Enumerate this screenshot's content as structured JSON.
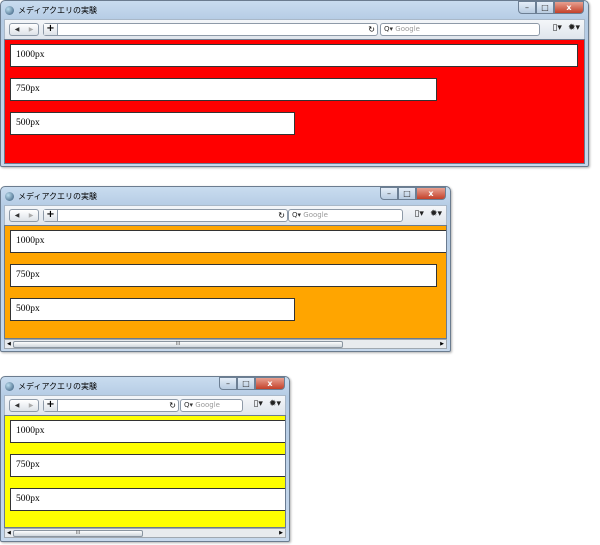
{
  "window_title": "メディアクエリの実験",
  "search_placeholder": "Google",
  "boxes": [
    "1000px",
    "750px",
    "500px"
  ],
  "colors": {
    "wide": "#ff0000",
    "medium": "#ffa500",
    "narrow": "#ffff00"
  },
  "icons": {
    "back": "◀",
    "forward": "▶",
    "new_tab": "+",
    "reload": "↻",
    "search": "🔍",
    "page": "page-icon",
    "tools": "gear-icon",
    "minimize": "–",
    "maximize": "□",
    "close": "x",
    "scroll_thumb": "III"
  }
}
